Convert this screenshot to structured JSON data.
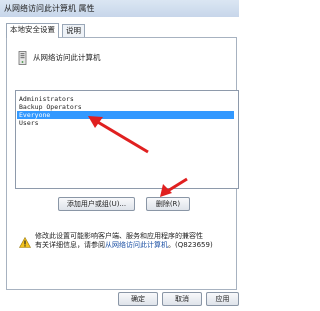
{
  "window": {
    "title": "从网络访问此计算机 属性"
  },
  "tabs": [
    {
      "label": "本地安全设置",
      "active": true
    },
    {
      "label": "说明",
      "active": false
    }
  ],
  "policy": {
    "name": "从网络访问此计算机",
    "icon": "server-icon"
  },
  "accounts": [
    {
      "name": "Administrators",
      "selected": false
    },
    {
      "name": "Backup Operators",
      "selected": false
    },
    {
      "name": "Everyone",
      "selected": true
    },
    {
      "name": "Users",
      "selected": false
    }
  ],
  "buttons": {
    "add": "添加用户或组(U)...",
    "remove": "删除(R)",
    "ok": "确定",
    "cancel": "取消",
    "apply": "应用"
  },
  "warning": {
    "icon": "warning-icon",
    "text": "修改此设置可能影响客户端、服务和应用程序的兼容性",
    "text2": "有关详细信息，请参阅",
    "link": "从网络访问此计算机",
    "code": "(Q823659)"
  },
  "colors": {
    "selection": "#3399ff",
    "annotation_arrow": "#e02020",
    "link": "#1a4fa3"
  }
}
